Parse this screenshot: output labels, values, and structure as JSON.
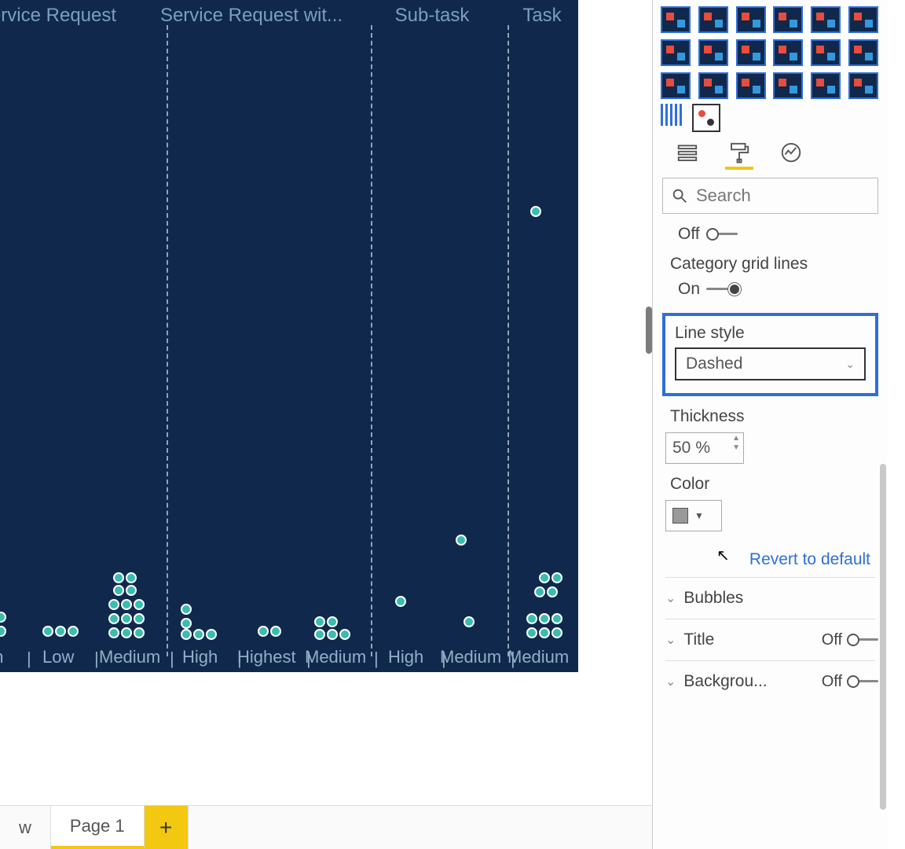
{
  "chart": {
    "columns": [
      "Service Request",
      "Service Request wit...",
      "Sub-task",
      "Task"
    ],
    "x_labels": [
      "gh",
      "Low",
      "Medium",
      "High",
      "Highest",
      "Medium",
      "High",
      "Medium",
      "Medium"
    ]
  },
  "tabs": {
    "partial_left": "w",
    "page1": "Page 1",
    "add": "+"
  },
  "panel": {
    "search_placeholder": "Search",
    "off_row_state": "Off",
    "category_grid_label": "Category grid lines",
    "category_grid_state": "On",
    "line_style_label": "Line style",
    "line_style_value": "Dashed",
    "thickness_label": "Thickness",
    "thickness_value": "50",
    "thickness_unit": "%",
    "color_label": "Color",
    "revert": "Revert to default",
    "accordions": {
      "bubbles": "Bubbles",
      "title": "Title",
      "title_state": "Off",
      "background": "Backgrou...",
      "background_state": "Off"
    }
  }
}
